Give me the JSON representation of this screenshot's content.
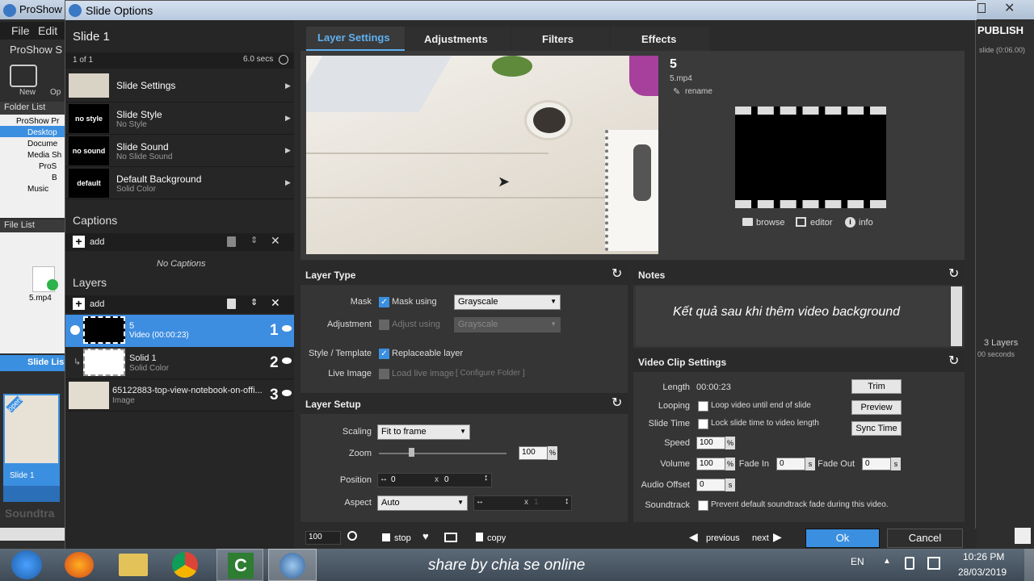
{
  "bg_app": {
    "title": "ProShow",
    "menu_file": "File",
    "menu_edit": "Edit",
    "app_short": "ProShow S",
    "new_label": "New",
    "op_label": "Op",
    "folder_list": "Folder List",
    "tree": [
      "ProShow Pr",
      "Desktop",
      "Docume",
      "Media Sh",
      "ProS",
      "B",
      "Music"
    ],
    "file_list": "File List",
    "file_name": "5.mp4",
    "slide_list": "Slide Lis",
    "open_badge": "open",
    "slide1": "Slide 1",
    "soundtrack": "Soundtra",
    "publish": "PUBLISH",
    "slide_time": "slide (0:06.00)",
    "layers3": "3 Layers",
    "seconds": "00 seconds"
  },
  "dialog": {
    "title": "Slide Options",
    "slide_name": "Slide 1",
    "count": "1 of 1",
    "duration": "6.0 secs",
    "menu": [
      {
        "thumb": "",
        "title": "Slide Settings",
        "sub": ""
      },
      {
        "thumb": "no style",
        "title": "Slide Style",
        "sub": "No Style"
      },
      {
        "thumb": "no sound",
        "title": "Slide Sound",
        "sub": "No Slide Sound"
      },
      {
        "thumb": "default",
        "title": "Default Background",
        "sub": "Solid Color"
      }
    ],
    "captions_head": "Captions",
    "captions_add": "add",
    "no_captions": "No Captions",
    "layers_head": "Layers",
    "layers_add": "add",
    "layers": [
      {
        "name": "5",
        "sub": "Video (00:00:23)",
        "num": "1"
      },
      {
        "name": "Solid 1",
        "sub": "Solid Color",
        "num": "2"
      },
      {
        "name": "65122883-top-view-notebook-on-offi...",
        "sub": "Image",
        "num": "3"
      }
    ],
    "tabs": [
      "Layer Settings",
      "Adjustments",
      "Filters",
      "Effects"
    ],
    "layer_info": {
      "name": "5",
      "file": "5.mp4",
      "rename": "rename",
      "browse": "browse",
      "editor": "editor",
      "info": "info"
    },
    "layer_type": {
      "head": "Layer Type",
      "mask_label": "Mask",
      "mask_using": "Mask using",
      "mask_value": "Grayscale",
      "adjustment_label": "Adjustment",
      "adjust_using": "Adjust using",
      "adjust_value": "Grayscale",
      "style_label": "Style / Template",
      "replaceable": "Replaceable layer",
      "live_label": "Live Image",
      "load_live": "Load live image",
      "configure": "[ Configure Folder ]"
    },
    "layer_setup": {
      "head": "Layer Setup",
      "scaling_label": "Scaling",
      "scaling_value": "Fit to frame",
      "zoom_label": "Zoom",
      "zoom_value": "100",
      "zoom_unit": "%",
      "position_label": "Position",
      "pos_x": "0",
      "pos_y": "0",
      "x_sep": "x",
      "aspect_label": "Aspect",
      "aspect_value": "Auto",
      "asp_x": "",
      "asp_y": "",
      "asp_x_ph": "",
      "asp_y_ph": "1"
    },
    "notes": {
      "head": "Notes",
      "text": "Kết quả sau khi thêm video background"
    },
    "video": {
      "head": "Video Clip Settings",
      "length_label": "Length",
      "length_value": "00:00:23",
      "trim": "Trim",
      "looping_label": "Looping",
      "looping_text": "Loop video until end of slide",
      "preview": "Preview",
      "slidetime_label": "Slide Time",
      "slidetime_text": "Lock slide time to video length",
      "sync": "Sync Time",
      "speed_label": "Speed",
      "speed_value": "100",
      "volume_label": "Volume",
      "volume_value": "100",
      "fadein_label": "Fade In",
      "fadein_value": "0",
      "fadeout_label": "Fade Out",
      "fadeout_value": "0",
      "offset_label": "Audio Offset",
      "offset_value": "0",
      "soundtrack_label": "Soundtrack",
      "soundtrack_text": "Prevent default soundtrack fade during this video.",
      "pct": "%",
      "s": "s"
    },
    "bottom": {
      "zoom": "100",
      "stop": "stop",
      "copy": "copy",
      "previous": "previous",
      "next": "next",
      "ok": "Ok",
      "cancel": "Cancel"
    }
  },
  "taskbar": {
    "caption": "share by chia se online",
    "lang": "EN",
    "time": "10:26 PM",
    "date": "28/03/2019"
  },
  "colors": {
    "accent": "#3b8fe0",
    "selected_row": "#3d8de0",
    "tab_active": "#5fb0f0"
  }
}
